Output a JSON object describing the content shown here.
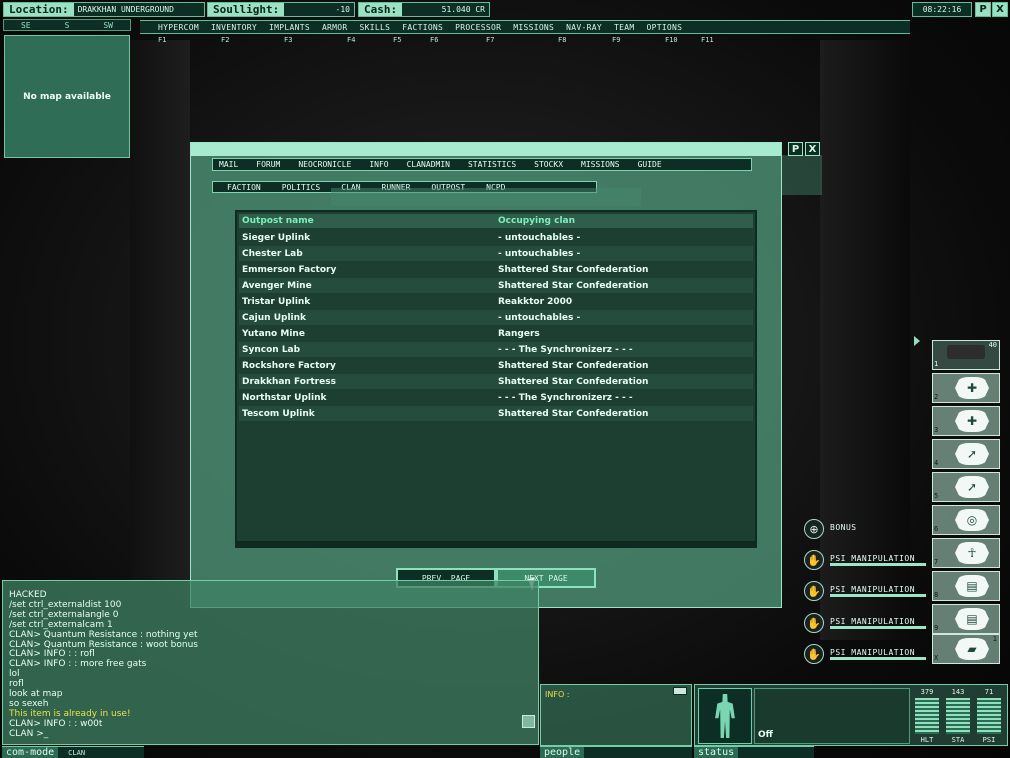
{
  "topbar": {
    "location_label": "Location:",
    "location_value": "DRAKKHAN UNDERGROUND",
    "soullight_label": "Soullight:",
    "soullight_value": "-10",
    "cash_label": "Cash:",
    "cash_value": "51.040 CR",
    "clock": "08:22:16",
    "btn_p": "P",
    "btn_x": "X"
  },
  "compass": [
    "SE",
    "S",
    "SW"
  ],
  "menu": [
    {
      "label": "HYPERCOM",
      "key": "F1"
    },
    {
      "label": "INVENTORY",
      "key": "F2"
    },
    {
      "label": "IMPLANTS",
      "key": "F3"
    },
    {
      "label": "ARMOR",
      "key": "F4"
    },
    {
      "label": "SKILLS",
      "key": "F5"
    },
    {
      "label": "FACTIONS",
      "key": "F6"
    },
    {
      "label": "PROCESSOR",
      "key": "F7"
    },
    {
      "label": "MISSIONS",
      "key": "F8"
    },
    {
      "label": "NAV-RAY",
      "key": "F9"
    },
    {
      "label": "TEAM",
      "key": "F10"
    },
    {
      "label": "OPTIONS",
      "key": "F11"
    }
  ],
  "minimap": {
    "text": "No map available"
  },
  "dialog": {
    "btn_p": "P",
    "btn_x": "X",
    "tabs": [
      "MAIL",
      "FORUM",
      "NEOCRONICLE",
      "INFO",
      "CLANADMIN",
      "STATISTICS",
      "STOCKX",
      "MISSIONS",
      "GUIDE"
    ],
    "subtabs": [
      "FACTION",
      "POLITICS",
      "CLAN",
      "RUNNER",
      "OUTPOST",
      "NCPD"
    ],
    "columns": {
      "name": "Outpost name",
      "clan": "Occupying clan"
    },
    "rows": [
      {
        "name": "Sieger Uplink",
        "clan": "- untouchables -"
      },
      {
        "name": "Chester Lab",
        "clan": "- untouchables -"
      },
      {
        "name": "Emmerson Factory",
        "clan": "Shattered Star Confederation"
      },
      {
        "name": "Avenger Mine",
        "clan": "Shattered Star Confederation"
      },
      {
        "name": "Tristar Uplink",
        "clan": "Reakktor 2000"
      },
      {
        "name": "Cajun Uplink",
        "clan": "- untouchables -"
      },
      {
        "name": "Yutano Mine",
        "clan": "Rangers"
      },
      {
        "name": "Syncon Lab",
        "clan": "- - - The Synchronizerz - - -"
      },
      {
        "name": "Rockshore Factory",
        "clan": "Shattered Star Confederation"
      },
      {
        "name": "Drakkhan Fortress",
        "clan": "Shattered Star Confederation"
      },
      {
        "name": "Northstar Uplink",
        "clan": "- - - The Synchronizerz - - -"
      },
      {
        "name": "Tescom Uplink",
        "clan": "Shattered Star Confederation"
      }
    ],
    "prev_label": "PREV. PAGE",
    "next_label": "NEXT PAGE"
  },
  "quickbar": {
    "ammo_count": "40",
    "slots": [
      {
        "num": "1",
        "icon": "rifle-icon"
      },
      {
        "num": "2",
        "icon": "heal-cross-icon",
        "glyph": "✚"
      },
      {
        "num": "3",
        "icon": "heal-cross-ring-icon",
        "glyph": "✚"
      },
      {
        "num": "4",
        "icon": "arrow-boost-icon",
        "glyph": "➚"
      },
      {
        "num": "5",
        "icon": "arrow-shield-icon",
        "glyph": "➚"
      },
      {
        "num": "6",
        "icon": "target-boost-icon",
        "glyph": "◎"
      },
      {
        "num": "7",
        "icon": "psi-figure-icon",
        "glyph": "☥"
      },
      {
        "num": "8",
        "icon": "chair-icon",
        "glyph": "▤"
      },
      {
        "num": "9",
        "icon": "chair-icon",
        "glyph": "▤"
      },
      {
        "num": "X",
        "icon": "battery-icon",
        "glyph": "▰"
      }
    ],
    "x_count": "1"
  },
  "buffs": [
    {
      "label": "BONUS",
      "icon": "bonus-icon",
      "glyph": "⊕"
    },
    {
      "label": "PSI MANIPULATION",
      "icon": "psi-hand-icon",
      "glyph": "✋"
    },
    {
      "label": "PSI MANIPULATION",
      "icon": "psi-hand-icon",
      "glyph": "✋"
    },
    {
      "label": "PSI MANIPULATION",
      "icon": "psi-hand-icon",
      "glyph": "✋"
    },
    {
      "label": "PSI MANIPULATION",
      "icon": "psi-hand-icon",
      "glyph": "✋"
    }
  ],
  "chat": {
    "lines": [
      {
        "text": "HACKED",
        "warn": false
      },
      {
        "text": "/set ctrl_externaldist 100",
        "warn": false
      },
      {
        "text": "/set ctrl_externalangle 0",
        "warn": false
      },
      {
        "text": "/set ctrl_externalcam 1",
        "warn": false
      },
      {
        "text": "CLAN> Quantum Resistance : nothing yet",
        "warn": false
      },
      {
        "text": "CLAN> Quantum Resistance : woot bonus",
        "warn": false
      },
      {
        "text": "CLAN> INFO : : rofl",
        "warn": false
      },
      {
        "text": "CLAN> INFO : : more free gats",
        "warn": false
      },
      {
        "text": "lol",
        "warn": false
      },
      {
        "text": "rofl",
        "warn": false
      },
      {
        "text": "look at map",
        "warn": false
      },
      {
        "text": "so sexeh",
        "warn": false
      },
      {
        "text": "This item is already in use!",
        "warn": true
      },
      {
        "text": "CLAN> INFO : : w00t",
        "warn": false
      },
      {
        "text": " CLAN >_",
        "warn": false
      }
    ],
    "mode_label": "com-mode",
    "mode_value": "CLAN"
  },
  "info": {
    "label": "INFO :"
  },
  "people_label": "people",
  "status": {
    "label": "status",
    "mode": "Off",
    "gauges": [
      {
        "value": "379",
        "label": "HLT"
      },
      {
        "value": "143",
        "label": "STA"
      },
      {
        "value": "71",
        "label": "PSI"
      }
    ]
  },
  "colors": {
    "accent": "#9ae0c2",
    "panel": "#0d2e24",
    "warn": "#e8e24a"
  }
}
